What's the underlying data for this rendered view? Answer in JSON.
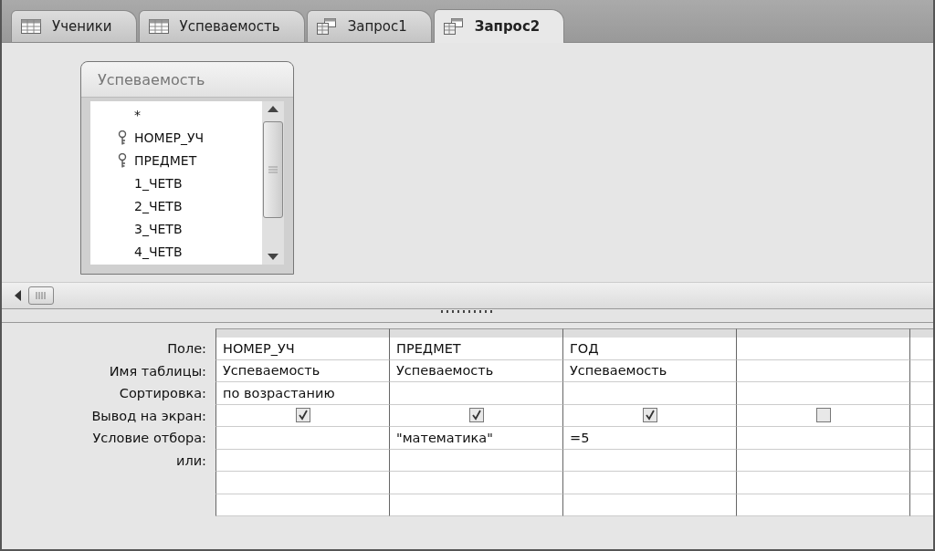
{
  "tabs": [
    {
      "label": "Ученики",
      "kind": "table",
      "selected": false
    },
    {
      "label": "Успеваемость",
      "kind": "table",
      "selected": false
    },
    {
      "label": "Запрос1",
      "kind": "query",
      "selected": false
    },
    {
      "label": "Запрос2",
      "kind": "query",
      "selected": true
    }
  ],
  "field_list": {
    "title": "Успеваемость",
    "fields": [
      {
        "name": "*",
        "key": false
      },
      {
        "name": "НОМЕР_УЧ",
        "key": true
      },
      {
        "name": "ПРЕДМЕТ",
        "key": true
      },
      {
        "name": "1_ЧЕТВ",
        "key": false
      },
      {
        "name": "2_ЧЕТВ",
        "key": false
      },
      {
        "name": "3_ЧЕТВ",
        "key": false
      },
      {
        "name": "4_ЧЕТВ",
        "key": false
      }
    ]
  },
  "grid": {
    "row_labels": [
      "Поле:",
      "Имя таблицы:",
      "Сортировка:",
      "Вывод на экран:",
      "Условие отбора:",
      "или:"
    ],
    "columns": [
      {
        "field": "НОМЕР_УЧ",
        "table": "Успеваемость",
        "sort": "по возрастанию",
        "show": true
      },
      {
        "field": "ПРЕДМЕТ",
        "table": "Успеваемость",
        "show": true,
        "criteria": "\"математика\""
      },
      {
        "field": "ГОД",
        "table": "Успеваемость",
        "show": true,
        "criteria": "=5"
      },
      {
        "show": false
      }
    ]
  }
}
